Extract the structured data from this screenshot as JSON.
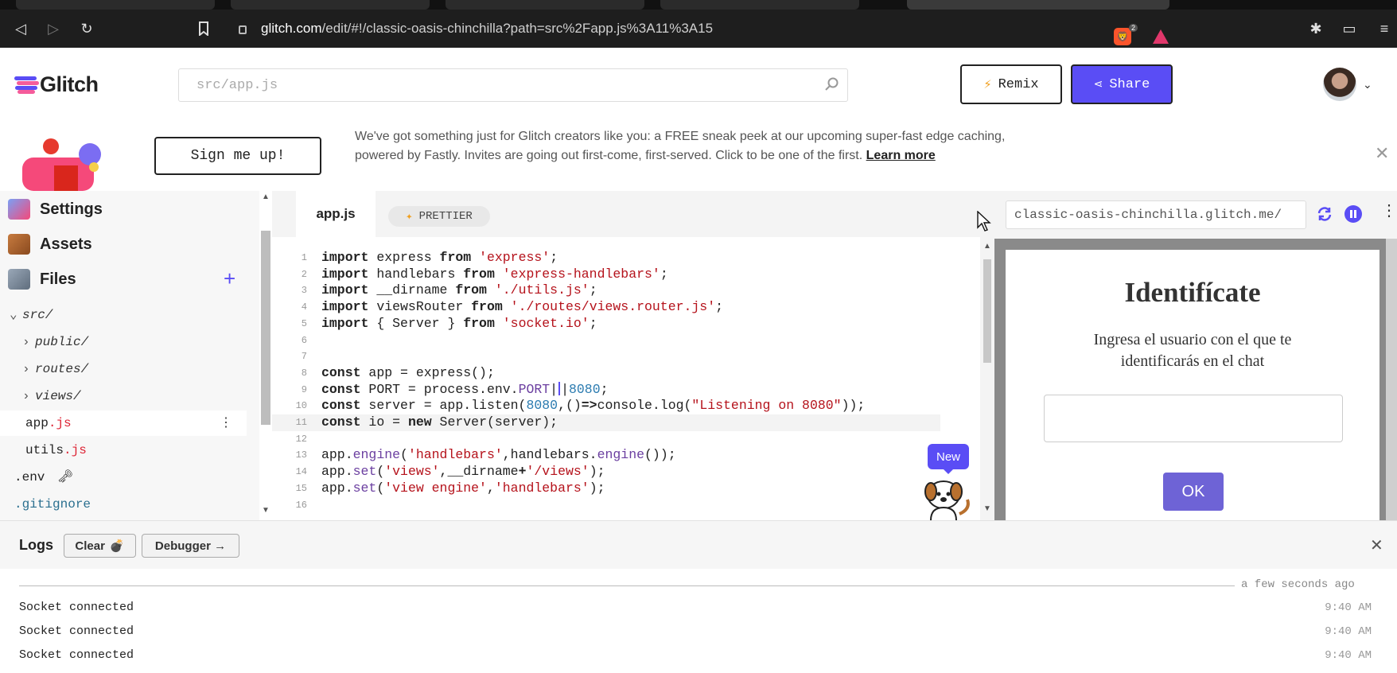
{
  "browser": {
    "url_host": "glitch.com",
    "url_path": "/edit/#!/classic-oasis-chinchilla?path=src%2Fapp.js%3A11%3A15",
    "brave_count": "2"
  },
  "header": {
    "logo_text": "Glitch",
    "search_placeholder": "src/app.js",
    "remix_label": "Remix",
    "share_label": "Share"
  },
  "banner": {
    "signup_label": "Sign me up!",
    "message": "We've got something just for Glitch creators like you: a FREE sneak peek at our upcoming super-fast edge caching, powered by Fastly. Invites are going out first-come, first-served. Click to be one of the first. ",
    "link_text": "Learn more"
  },
  "sidebar": {
    "items": [
      {
        "label": "Settings"
      },
      {
        "label": "Assets"
      },
      {
        "label": "Files"
      }
    ],
    "tree": [
      {
        "label": "src/",
        "kind": "folder",
        "open": true
      },
      {
        "label": "public/",
        "kind": "folder"
      },
      {
        "label": "routes/",
        "kind": "folder"
      },
      {
        "label": "views/",
        "kind": "folder"
      },
      {
        "name": "app",
        "ext": ".js",
        "kind": "file"
      },
      {
        "name": "utils",
        "ext": ".js",
        "kind": "file"
      },
      {
        "label": ".env",
        "kind": "file"
      },
      {
        "label": ".gitignore",
        "kind": "file"
      }
    ]
  },
  "editor": {
    "tab_label": "app.js",
    "prettier_label": "PRETTIER",
    "new_badge": "New",
    "lines": [
      {
        "n": "1",
        "code": "import express from 'express';"
      },
      {
        "n": "2",
        "code": "import handlebars from 'express-handlebars';"
      },
      {
        "n": "3",
        "code": "import __dirname from './utils.js';"
      },
      {
        "n": "4",
        "code": "import viewsRouter from './routes/views.router.js';"
      },
      {
        "n": "5",
        "code": "import { Server } from 'socket.io';"
      },
      {
        "n": "6",
        "code": ""
      },
      {
        "n": "7",
        "code": ""
      },
      {
        "n": "8",
        "code": "const app = express();"
      },
      {
        "n": "9",
        "code": "const PORT = process.env.PORT||8080;"
      },
      {
        "n": "10",
        "code": "const server = app.listen(8080,()=>console.log(\"Listening on 8080\"));"
      },
      {
        "n": "11",
        "code": "const io = new Server(server);"
      },
      {
        "n": "12",
        "code": ""
      },
      {
        "n": "13",
        "code": "app.engine('handlebars',handlebars.engine());"
      },
      {
        "n": "14",
        "code": "app.set('views',__dirname+'/views');"
      },
      {
        "n": "15",
        "code": "app.set('view engine','handlebars');"
      },
      {
        "n": "16",
        "code": ""
      }
    ]
  },
  "preview": {
    "url": "classic-oasis-chinchilla.glitch.me/",
    "title": "Identifícate",
    "subtitle": "Ingresa el usuario con el que te identificarás en el chat",
    "ok_label": "OK"
  },
  "logs": {
    "title": "Logs",
    "clear_label": "Clear",
    "debugger_label": "Debugger →",
    "ago": "a few seconds ago",
    "entries": [
      {
        "text": "Socket connected",
        "time": "9:40 AM"
      },
      {
        "text": "Socket connected",
        "time": "9:40 AM"
      },
      {
        "text": "Socket connected",
        "time": "9:40 AM"
      }
    ]
  },
  "colors": {
    "accent": "#5a4df5",
    "string": "#b5121b",
    "number": "#2b7bb0"
  }
}
